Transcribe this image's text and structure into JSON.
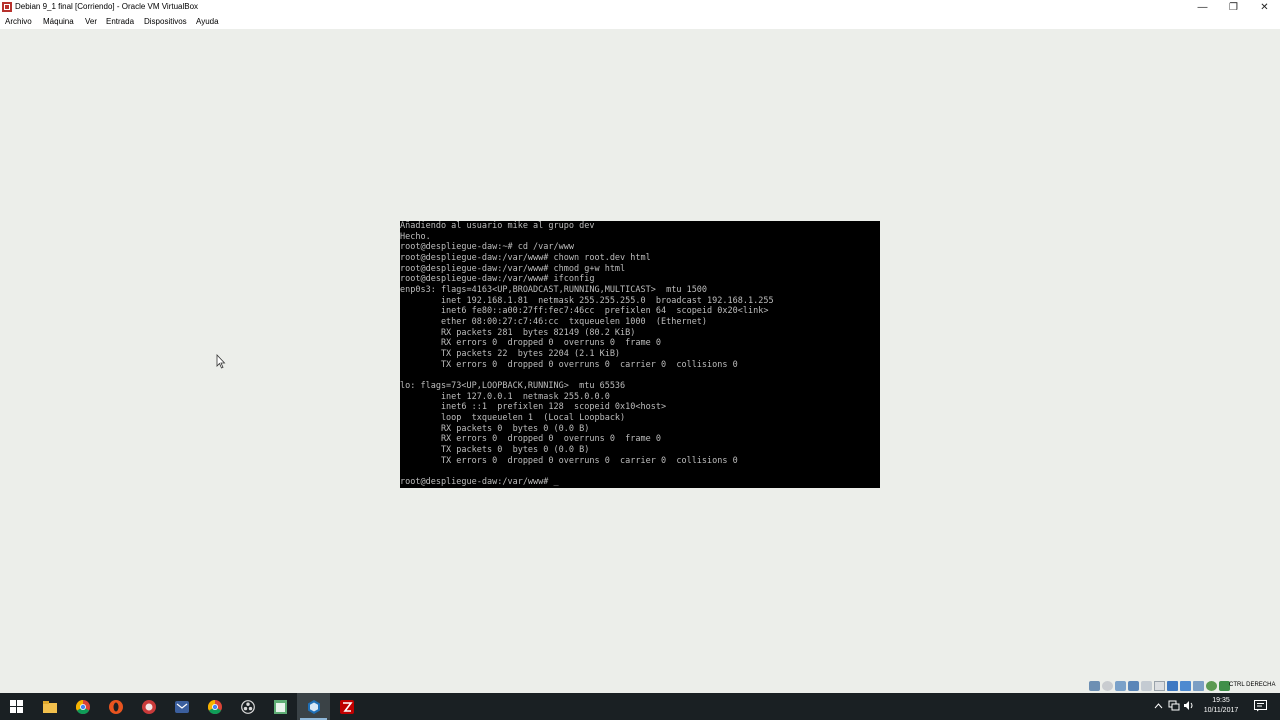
{
  "window": {
    "title": "Debian 9_1 final [Corriendo] - Oracle VM VirtualBox",
    "controls": {
      "minimize": "—",
      "maximize": "❐",
      "close": "✕"
    }
  },
  "menu": [
    "Archivo",
    "Máquina",
    "Ver",
    "Entrada",
    "Dispositivos",
    "Ayuda"
  ],
  "console": {
    "lines": [
      "Añadiendo al usuario mike al grupo dev",
      "Hecho.",
      "root@despliegue-daw:~# cd /var/www",
      "root@despliegue-daw:/var/www# chown root.dev html",
      "root@despliegue-daw:/var/www# chmod g+w html",
      "root@despliegue-daw:/var/www# ifconfig",
      "enp0s3: flags=4163<UP,BROADCAST,RUNNING,MULTICAST>  mtu 1500",
      "        inet 192.168.1.81  netmask 255.255.255.0  broadcast 192.168.1.255",
      "        inet6 fe80::a00:27ff:fec7:46cc  prefixlen 64  scopeid 0x20<link>",
      "        ether 08:00:27:c7:46:cc  txqueuelen 1000  (Ethernet)",
      "        RX packets 281  bytes 82149 (80.2 KiB)",
      "        RX errors 0  dropped 0  overruns 0  frame 0",
      "        TX packets 22  bytes 2204 (2.1 KiB)",
      "        TX errors 0  dropped 0 overruns 0  carrier 0  collisions 0",
      "",
      "lo: flags=73<UP,LOOPBACK,RUNNING>  mtu 65536",
      "        inet 127.0.0.1  netmask 255.0.0.0",
      "        inet6 ::1  prefixlen 128  scopeid 0x10<host>",
      "        loop  txqueuelen 1  (Local Loopback)",
      "        RX packets 0  bytes 0 (0.0 B)",
      "        RX errors 0  dropped 0  overruns 0  frame 0",
      "        TX packets 0  bytes 0 (0.0 B)",
      "        TX errors 0  dropped 0 overruns 0  carrier 0  collisions 0",
      "",
      "root@despliegue-daw:/var/www# _"
    ]
  },
  "status_bar": {
    "host_key": "CTRL DERECHA"
  },
  "taskbar": {
    "apps": [
      "windows-start-icon",
      "file-explorer-icon",
      "chrome-icon",
      "opera-icon",
      "app-icon",
      "mail-icon",
      "chrome-icon",
      "obs-icon",
      "notepad-icon",
      "virtualbox-icon",
      "filezilla-icon"
    ],
    "active_index": 9,
    "clock": {
      "time": "19:35",
      "date": "10/11/2017"
    }
  },
  "colors": {
    "desktop_bg": "#eceeea",
    "console_bg": "#000000",
    "console_text": "#bdbdbd",
    "taskbar_bg": "#1a2023"
  }
}
